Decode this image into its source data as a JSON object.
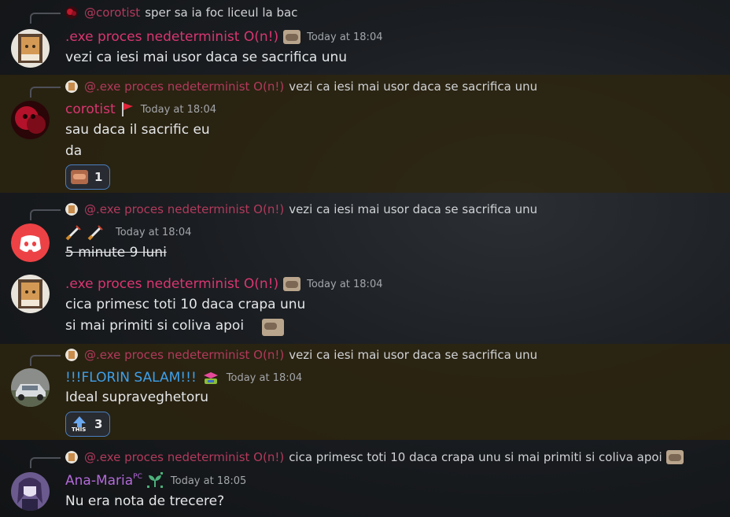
{
  "messages": [
    {
      "reply_author": "@corotist",
      "reply_text": "sper sa ia foc liceul la bac"
    },
    {
      "author": ".exe proces nedeterminist O(n!)",
      "timestamp": "Today at 18:04",
      "lines": [
        "vezi ca iesi mai usor daca se sacrifica unu"
      ],
      "author_color": "#d9366f"
    },
    {
      "reply_author": "@.exe proces nedeterminist O(n!)",
      "reply_text": "vezi ca iesi mai usor daca se sacrifica unu",
      "author": "corotist",
      "timestamp": "Today at 18:04",
      "lines": [
        "sau daca il sacrific eu",
        "da"
      ],
      "reaction_count": "1",
      "author_color": "#d9366f"
    },
    {
      "reply_author": "@.exe proces nedeterminist O(n!)",
      "reply_text": "vezi ca iesi mai usor daca se sacrifica unu",
      "timestamp": "Today at 18:04",
      "lines": [
        "5 minute 9 luni"
      ]
    },
    {
      "author": ".exe proces nedeterminist O(n!)",
      "timestamp": "Today at 18:04",
      "lines": [
        "cica primesc toti 10 daca crapa unu",
        "si mai primiti si coliva apoi"
      ],
      "author_color": "#d9366f"
    },
    {
      "reply_author": "@.exe proces nedeterminist O(n!)",
      "reply_text": "vezi ca iesi mai usor daca se sacrifica unu",
      "author": "!!!FLORIN SALAM!!!",
      "timestamp": "Today at 18:04",
      "lines": [
        "Ideal supraveghetoru"
      ],
      "reaction_count": "3",
      "reaction_label": "THIS",
      "author_color": "#3ea0ea"
    },
    {
      "reply_author": "@.exe proces nedeterminist O(n!)",
      "reply_text": "cica primesc toti 10 daca crapa unu si mai primiti si coliva apoi",
      "author": "Ana-Maria",
      "author_tag": "PC",
      "timestamp": "Today at 18:05",
      "lines": [
        "Nu era nota de trecere?"
      ],
      "author_color": "#b36ad9"
    }
  ],
  "colors": {
    "highlight_bg": "#2e250e",
    "mention_red": "#b23a5c",
    "reaction_border": "#4a7fc0",
    "discord_red": "#ed4245"
  }
}
